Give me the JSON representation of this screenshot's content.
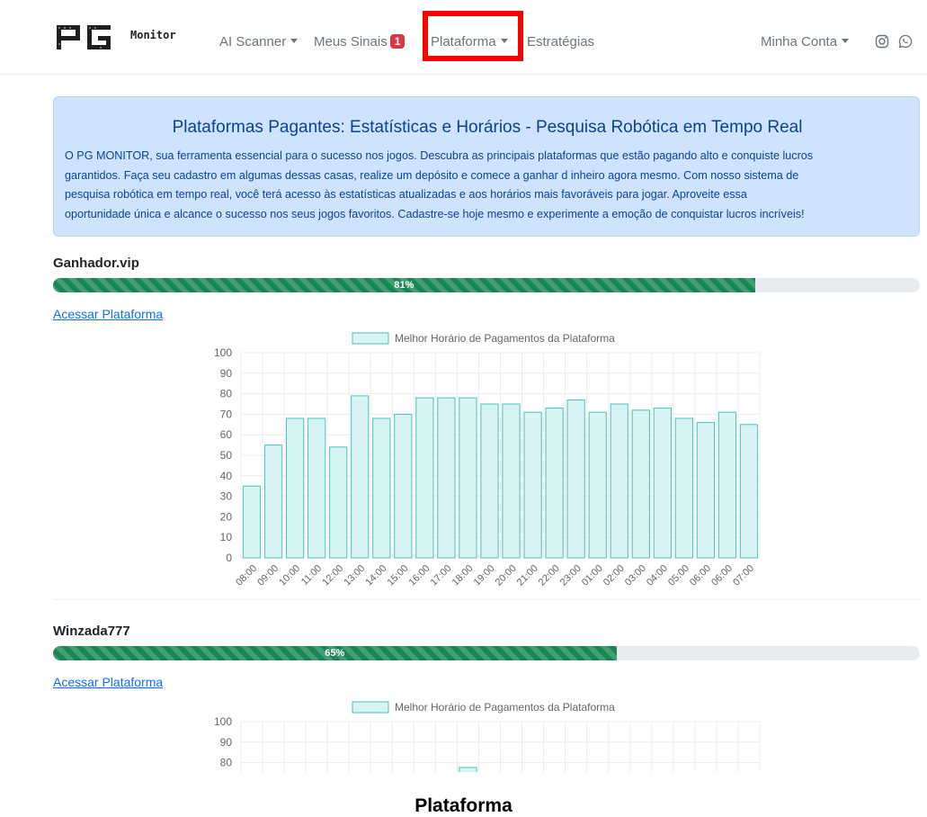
{
  "nav": {
    "logo_text_big": "PG",
    "logo_text_small": "Monitor",
    "items": [
      {
        "label": "AI Scanner",
        "dropdown": true
      },
      {
        "label": "Meus Sinais",
        "badge": "1"
      },
      {
        "label": "Plataforma",
        "dropdown": true
      },
      {
        "label": "Estratégias"
      }
    ],
    "account_label": "Minha Conta",
    "icons": [
      "instagram-icon",
      "whatsapp-icon"
    ],
    "highlight_color": "#ff0000"
  },
  "alert": {
    "title": "Plataformas Pagantes: Estatísticas e Horários - Pesquisa Robótica em Tempo Real",
    "lines": [
      "O PG MONITOR, sua ferramenta essencial para o sucesso nos jogos. Descubra as principais plataformas que estão pagando alto e conquiste lucros",
      "garantidos. Faça seu cadastro em algumas dessas casas, realize um depósito e comece a ganhar d inheiro agora mesmo. Com nosso sistema de",
      "pesquisa robótica em tempo real, você terá acesso às estatísticas atualizadas e aos horários mais favoráveis para jogar. Aproveite essa",
      "oportunidade única e alcance o sucesso nos seus jogos favoritos. Cadastre-se hoje mesmo e experimente a emoção de conquistar lucros incríveis!"
    ]
  },
  "platforms": [
    {
      "name": "Ganhador.vip",
      "progress_label": "81%",
      "link_label": "Acessar Plataforma"
    },
    {
      "name": "Winzada777",
      "progress_label": "65%",
      "link_label": "Acessar Plataforma"
    }
  ],
  "caption": "Plataforma",
  "colors": {
    "progress": "#198754",
    "bar_fill": "#d7f3f3",
    "bar_stroke": "#4bc0c0",
    "alert_bg": "#cfe2ff",
    "link": "#0d6efd"
  },
  "chart_data": [
    {
      "type": "bar",
      "legend": "Melhor Horário de Pagamentos da Plataforma",
      "categories": [
        "08:00",
        "09:00",
        "10:00",
        "11:00",
        "12:00",
        "13:00",
        "14:00",
        "15:00",
        "16:00",
        "17:00",
        "18:00",
        "19:00",
        "20:00",
        "21:00",
        "22:00",
        "23:00",
        "01:00",
        "02:00",
        "03:00",
        "04:00",
        "05:00",
        "06:00",
        "06:00",
        "07:00"
      ],
      "values": [
        35,
        55,
        68,
        68,
        54,
        79,
        68,
        70,
        78,
        78,
        78,
        75,
        75,
        71,
        73,
        77,
        71,
        75,
        72,
        73,
        68,
        66,
        71,
        65
      ],
      "ylim": [
        0,
        100
      ],
      "yticks": [
        0,
        10,
        20,
        30,
        40,
        50,
        60,
        70,
        80,
        90,
        100
      ]
    },
    {
      "type": "bar",
      "legend": "Melhor Horário de Pagamentos da Plataforma",
      "ylim": [
        0,
        100
      ],
      "yticks": [
        80,
        90,
        100
      ]
    }
  ]
}
